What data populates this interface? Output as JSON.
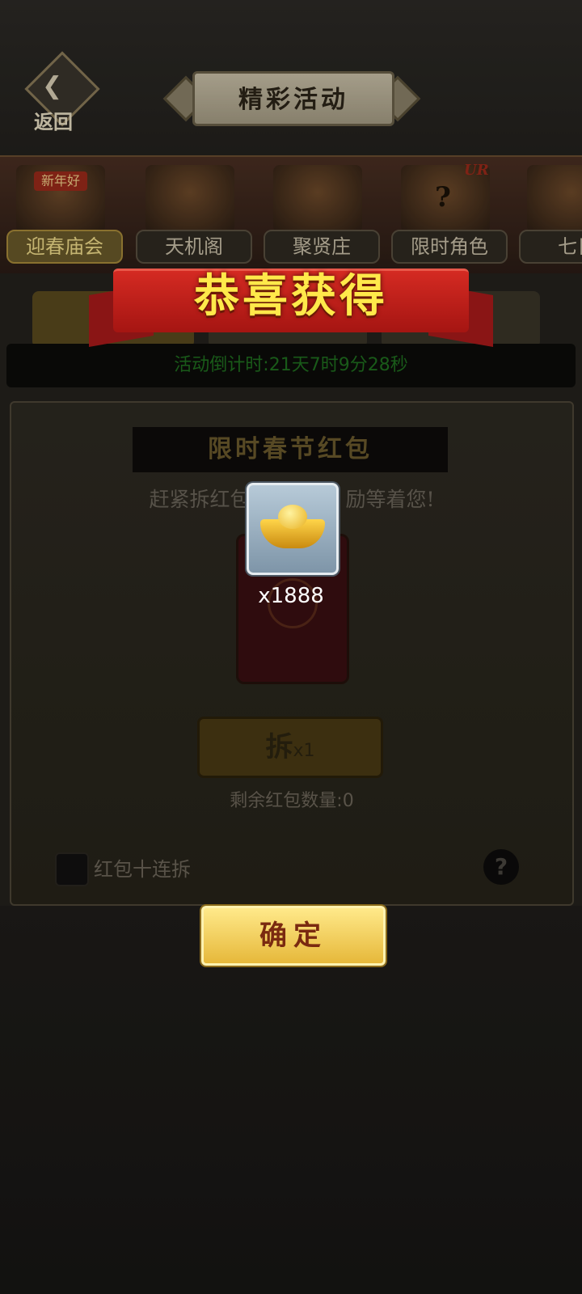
{
  "header": {
    "back_label": "返回",
    "title": "精彩活动"
  },
  "tabs": [
    {
      "label": "迎春庙会",
      "active": true,
      "art_text": "新年好"
    },
    {
      "label": "天机阁",
      "active": false
    },
    {
      "label": "聚贤庄",
      "active": false
    },
    {
      "label": "限时角色",
      "active": false,
      "badge": "UR"
    },
    {
      "label": "七日",
      "active": false
    }
  ],
  "countdown": "活动倒计时:21天7时9分28秒",
  "panel": {
    "title": "限时春节红包",
    "subtitle": "赶紧拆红包",
    "subtitle_tail": "励等着您!",
    "open_button": "拆",
    "open_count": "x1",
    "remaining": "剩余红包数量:0",
    "ten_open_label": "红包十连拆",
    "help_symbol": "?"
  },
  "reward_popup": {
    "banner": "恭喜获得",
    "item_icon": "gold-ingot-icon",
    "quantity": "x1888",
    "confirm": "确定"
  },
  "colors": {
    "banner_red": "#c8201a",
    "banner_text": "#ffe94a",
    "confirm_gold": "#f2cf5a",
    "countdown_green": "#1f6e1f"
  }
}
